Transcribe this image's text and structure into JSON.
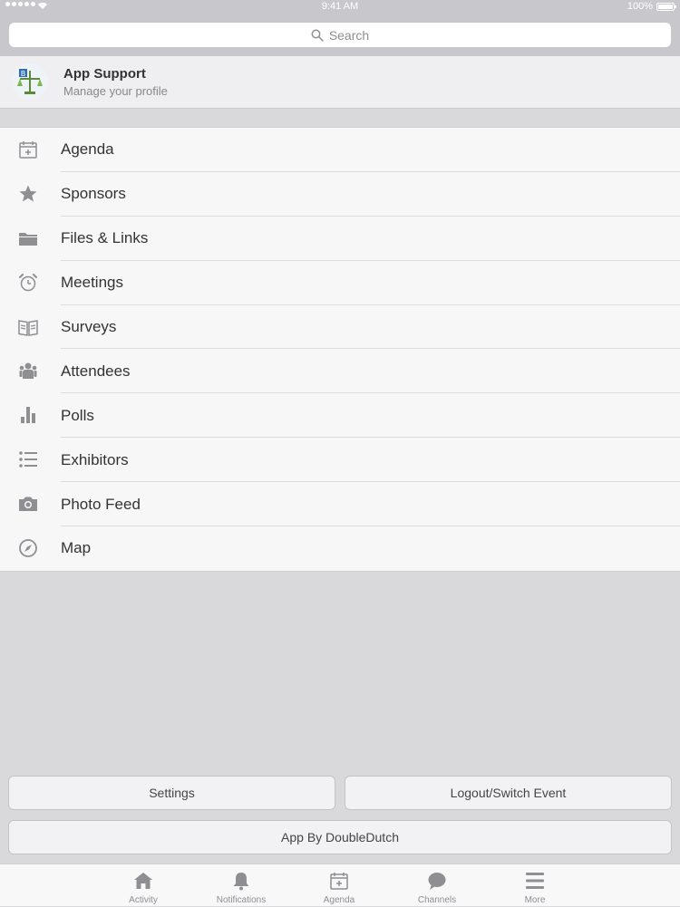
{
  "status_bar": {
    "time": "9:41 AM",
    "battery_percent": "100%",
    "signal_icon": "signal-dots-icon",
    "wifi_icon": "wifi-icon",
    "battery_icon": "battery-icon"
  },
  "search": {
    "placeholder": "Search",
    "icon": "search-icon"
  },
  "profile": {
    "name": "App Support",
    "subtitle": "Manage your profile",
    "avatar_icon": "scales-logo-icon"
  },
  "menu": [
    {
      "label": "Agenda",
      "icon": "calendar-icon"
    },
    {
      "label": "Sponsors",
      "icon": "star-icon"
    },
    {
      "label": "Files & Links",
      "icon": "folder-icon"
    },
    {
      "label": "Meetings",
      "icon": "alarm-clock-icon"
    },
    {
      "label": "Surveys",
      "icon": "book-icon"
    },
    {
      "label": "Attendees",
      "icon": "people-icon"
    },
    {
      "label": "Polls",
      "icon": "bar-chart-icon"
    },
    {
      "label": "Exhibitors",
      "icon": "list-icon"
    },
    {
      "label": "Photo Feed",
      "icon": "camera-icon"
    },
    {
      "label": "Map",
      "icon": "compass-icon"
    }
  ],
  "buttons": {
    "settings": "Settings",
    "logout": "Logout/Switch Event",
    "app_by": "App By DoubleDutch"
  },
  "tabbar": [
    {
      "label": "Activity",
      "icon": "home-icon"
    },
    {
      "label": "Notifications",
      "icon": "bell-icon"
    },
    {
      "label": "Agenda",
      "icon": "calendar-icon"
    },
    {
      "label": "Channels",
      "icon": "chat-bubble-icon"
    },
    {
      "label": "More",
      "icon": "menu-icon"
    }
  ],
  "colors": {
    "icon_gray": "#8e8e93",
    "background": "#d9d9db",
    "search_band": "#c8c8cc"
  }
}
